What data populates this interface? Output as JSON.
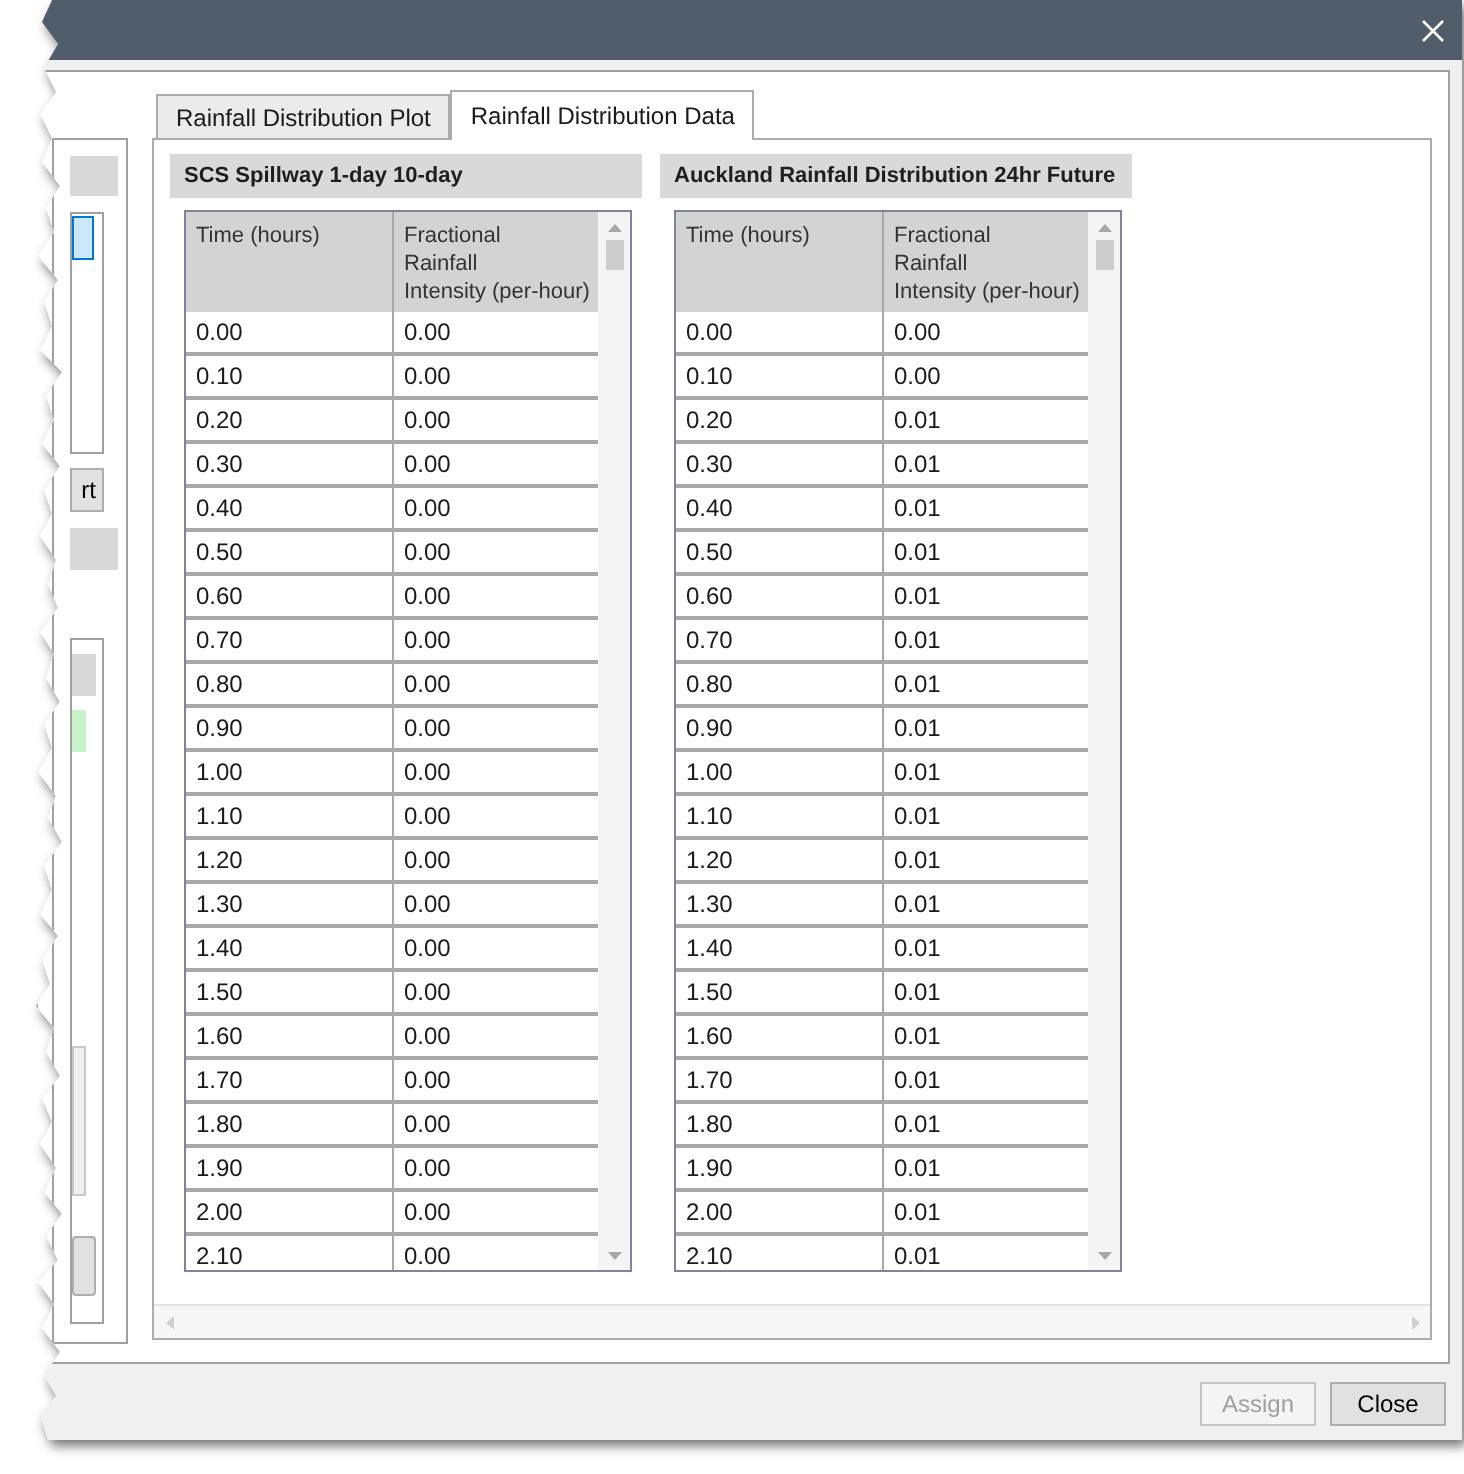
{
  "side_panel": {
    "list_items": [
      {
        "selected": true
      }
    ],
    "button": "rt",
    "lower_list_items": [
      {
        "selected": true
      }
    ]
  },
  "tabs": [
    {
      "label": "Rainfall Distribution Plot",
      "selected": false
    },
    {
      "label": "Rainfall Distribution Data",
      "selected": true
    }
  ],
  "tables": [
    {
      "title": "SCS Spillway 1-day 10-day",
      "columns": [
        "Time (hours)",
        "Fractional\nRainfall\nIntensity (per-hour)"
      ],
      "rows": [
        [
          "0.00",
          "0.00"
        ],
        [
          "0.10",
          "0.00"
        ],
        [
          "0.20",
          "0.00"
        ],
        [
          "0.30",
          "0.00"
        ],
        [
          "0.40",
          "0.00"
        ],
        [
          "0.50",
          "0.00"
        ],
        [
          "0.60",
          "0.00"
        ],
        [
          "0.70",
          "0.00"
        ],
        [
          "0.80",
          "0.00"
        ],
        [
          "0.90",
          "0.00"
        ],
        [
          "1.00",
          "0.00"
        ],
        [
          "1.10",
          "0.00"
        ],
        [
          "1.20",
          "0.00"
        ],
        [
          "1.30",
          "0.00"
        ],
        [
          "1.40",
          "0.00"
        ],
        [
          "1.50",
          "0.00"
        ],
        [
          "1.60",
          "0.00"
        ],
        [
          "1.70",
          "0.00"
        ],
        [
          "1.80",
          "0.00"
        ],
        [
          "1.90",
          "0.00"
        ],
        [
          "2.00",
          "0.00"
        ],
        [
          "2.10",
          "0.00"
        ]
      ]
    },
    {
      "title": "Auckland Rainfall Distribution 24hr Future",
      "columns": [
        "Time (hours)",
        "Fractional\nRainfall\nIntensity (per-hour)"
      ],
      "rows": [
        [
          "0.00",
          "0.00"
        ],
        [
          "0.10",
          "0.00"
        ],
        [
          "0.20",
          "0.01"
        ],
        [
          "0.30",
          "0.01"
        ],
        [
          "0.40",
          "0.01"
        ],
        [
          "0.50",
          "0.01"
        ],
        [
          "0.60",
          "0.01"
        ],
        [
          "0.70",
          "0.01"
        ],
        [
          "0.80",
          "0.01"
        ],
        [
          "0.90",
          "0.01"
        ],
        [
          "1.00",
          "0.01"
        ],
        [
          "1.10",
          "0.01"
        ],
        [
          "1.20",
          "0.01"
        ],
        [
          "1.30",
          "0.01"
        ],
        [
          "1.40",
          "0.01"
        ],
        [
          "1.50",
          "0.01"
        ],
        [
          "1.60",
          "0.01"
        ],
        [
          "1.70",
          "0.01"
        ],
        [
          "1.80",
          "0.01"
        ],
        [
          "1.90",
          "0.01"
        ],
        [
          "2.00",
          "0.01"
        ],
        [
          "2.10",
          "0.01"
        ]
      ]
    }
  ],
  "buttons": [
    {
      "label": "Assign",
      "disabled": true
    },
    {
      "label": "Close",
      "disabled": false
    }
  ]
}
